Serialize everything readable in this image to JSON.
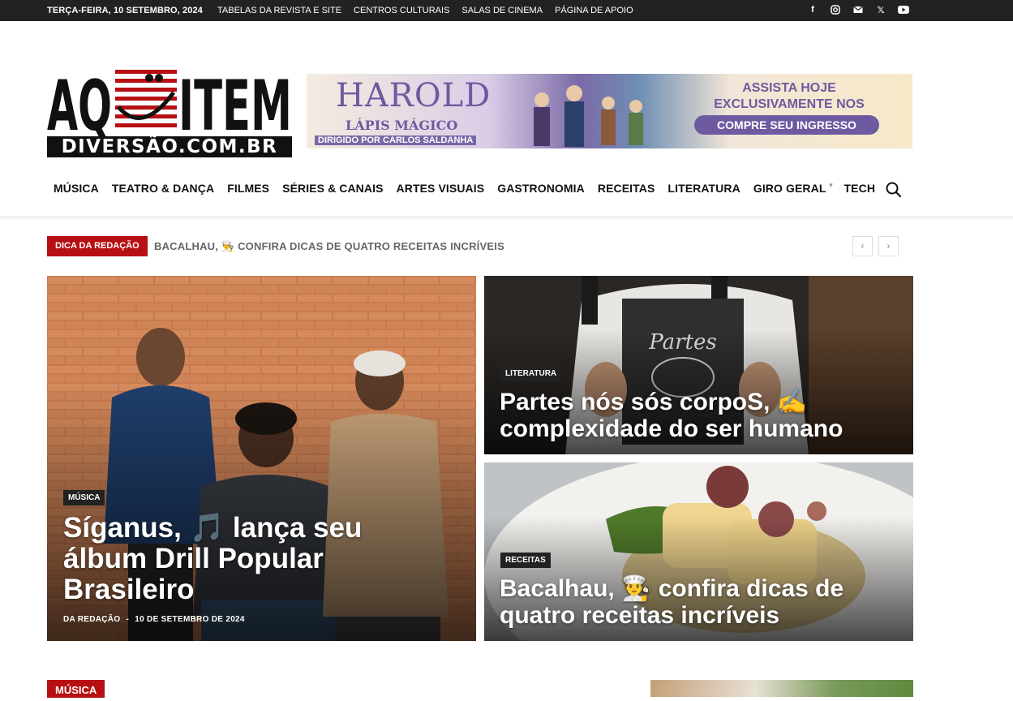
{
  "topbar": {
    "date": "TERÇA-FEIRA, 10 SETEMBRO, 2024",
    "links": [
      "TABELAS DA REVISTA E SITE",
      "CENTROS CULTURAIS",
      "SALAS DE CINEMA",
      "PÁGINA DE APOIO"
    ],
    "social_icons": [
      "facebook-icon",
      "instagram-icon",
      "mail-icon",
      "x-icon",
      "youtube-icon"
    ]
  },
  "logo": {
    "main_left": "AQ",
    "main_right": "ITEM",
    "sub": "DIVERSÃO.COM.BR"
  },
  "banner": {
    "title": "HAROLD",
    "subtitle": "LÁPIS MÁGICO",
    "director": "DIRIGIDO POR CARLOS SALDANHA",
    "line1": "ASSISTA HOJE",
    "line2": "EXCLUSIVAMENTE NOS CINEMAS",
    "cta": "COMPRE SEU INGRESSO"
  },
  "nav": {
    "items": [
      "MÚSICA",
      "TEATRO & DANÇA",
      "FILMES",
      "SÉRIES & CANAIS",
      "ARTES VISUAIS",
      "GASTRONOMIA",
      "RECEITAS",
      "LITERATURA",
      "GIRO GERAL",
      "TECH"
    ]
  },
  "ticker": {
    "label": "DICA DA REDAÇÃO",
    "text": "BACALHAU, 👨‍🍳 CONFIRA DICAS DE QUATRO RECEITAS INCRÍVEIS"
  },
  "featured": {
    "main": {
      "category": "MÚSICA",
      "title": "Síganus, 🎵 lança seu álbum Drill Popular Brasileiro",
      "author": "DA REDAÇÃO",
      "separator": "-",
      "date": "10 DE SETEMBRO DE 2024"
    },
    "top_right": {
      "category": "LITERATURA",
      "title": "Partes nós sós corpoS, ✍️ complexidade do ser humano"
    },
    "bottom_right": {
      "category": "RECEITAS",
      "title": "Bacalhau, 👨‍🍳 confira dicas de quatro receitas incríveis"
    }
  },
  "section": {
    "label": "MÚSICA"
  },
  "colors": {
    "accent": "#b70f13",
    "topbar": "#222222"
  }
}
